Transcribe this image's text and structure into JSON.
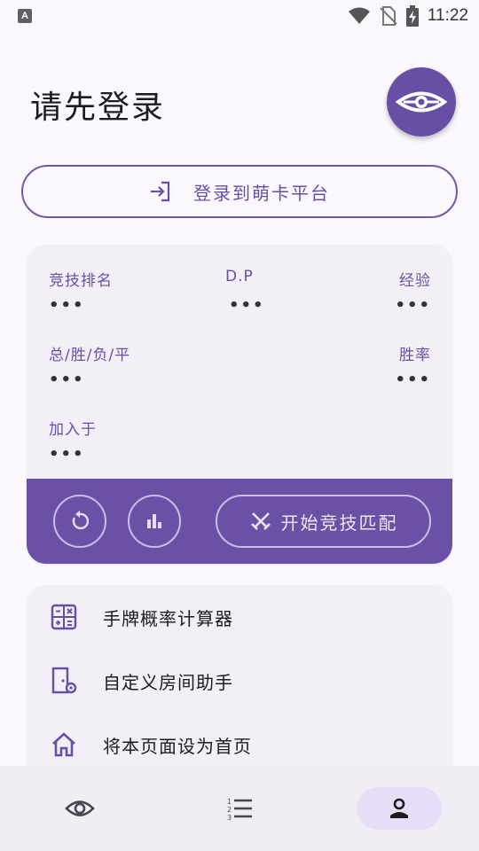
{
  "status_bar": {
    "app_icon_letter": "A",
    "time": "11:22",
    "icons": [
      "wifi-icon",
      "no-sim-icon",
      "battery-charging-icon"
    ]
  },
  "header": {
    "title": "请先登录",
    "logo_icon": "eye-logo-icon"
  },
  "login_button": {
    "label": "登录到萌卡平台",
    "icon": "login-icon"
  },
  "stats": {
    "rank_label": "竞技排名",
    "rank_value": "•••",
    "dp_label": "D.P",
    "dp_value": "•••",
    "exp_label": "经验",
    "exp_value": "•••",
    "record_label": "总/胜/负/平",
    "record_value": "•••",
    "winrate_label": "胜率",
    "winrate_value": "•••",
    "joined_label": "加入于",
    "joined_value": "•••"
  },
  "actions": {
    "refresh_icon": "refresh-icon",
    "stats_icon": "bar-chart-icon",
    "start_match_label": "开始竞技匹配",
    "start_match_icon": "crossed-swords-icon"
  },
  "tools": [
    {
      "label": "手牌概率计算器",
      "icon": "calculator-icon"
    },
    {
      "label": "自定义房间助手",
      "icon": "door-settings-icon"
    },
    {
      "label": "将本页面设为首页",
      "icon": "home-icon"
    }
  ],
  "bottom_nav": [
    {
      "icon": "eye-icon",
      "active": false
    },
    {
      "icon": "numbered-list-icon",
      "active": false
    },
    {
      "icon": "person-icon",
      "active": true
    }
  ],
  "colors": {
    "primary": "#6750a4",
    "action_bar": "#6a51a6",
    "card_bg": "#f3eff6",
    "nav_active": "#e6def6"
  }
}
